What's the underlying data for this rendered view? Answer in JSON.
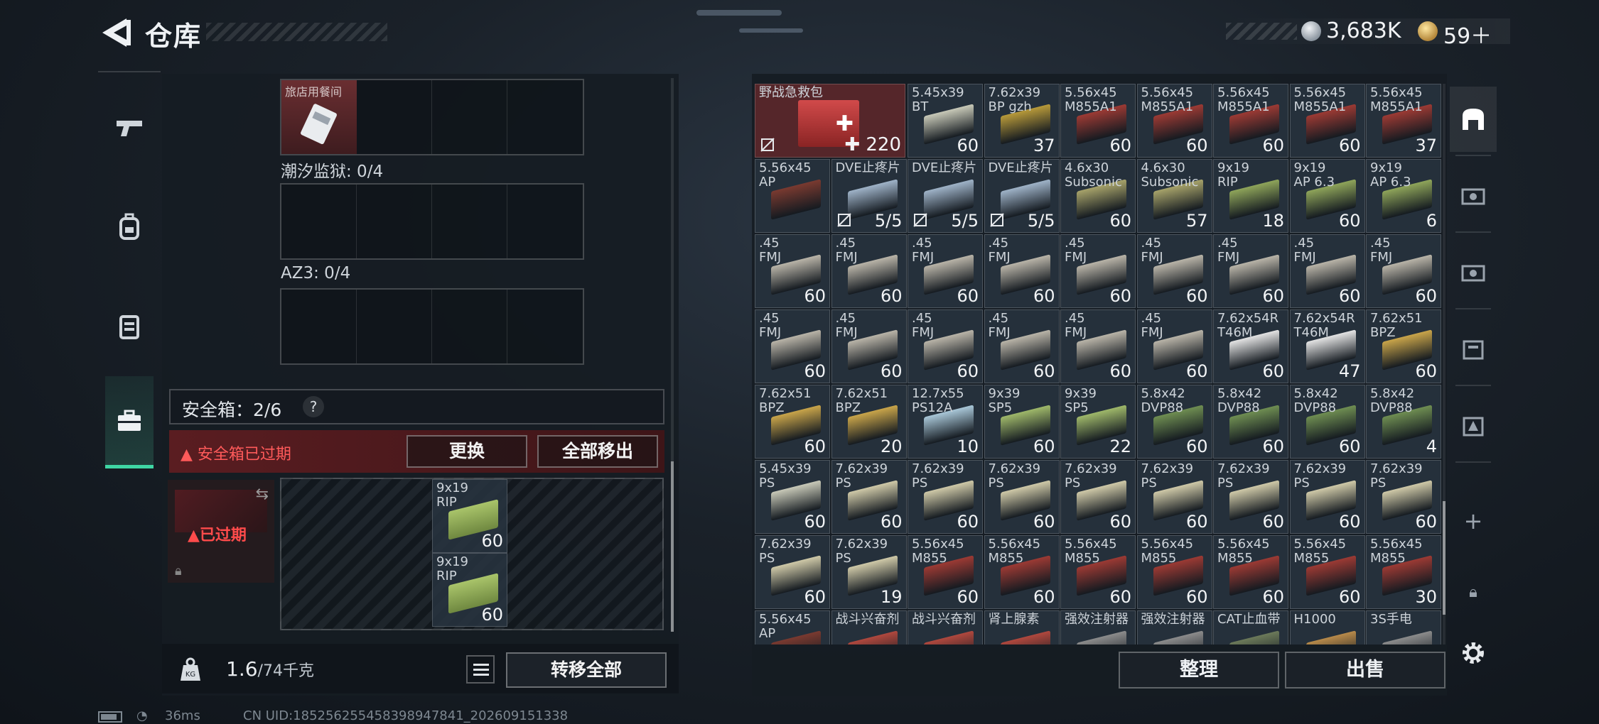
{
  "header": {
    "title": "仓库",
    "currency": [
      {
        "name": "silver-coin-icon",
        "value": "3,683K"
      },
      {
        "name": "gold-coin-icon",
        "value": "59＋"
      }
    ]
  },
  "left_tabs": [
    "pistol-icon",
    "backpack-icon",
    "vest-icon",
    "safebox-icon"
  ],
  "left_panel": {
    "top_item_name": "旅店用餐间",
    "slot_labels": [
      "潮汐监狱: 0/4",
      "AZ3: 0/4"
    ],
    "safebox_label": "安全箱：2/6",
    "safebox_help": "?",
    "expired_warning": "安全箱已过期",
    "replace_button": "更换",
    "remove_all_button": "全部移出",
    "expired_badge": "已过期",
    "safe_items": [
      {
        "name": "9x19\nRIP",
        "count": "60"
      },
      {
        "name": "9x19\nRIP",
        "count": "60"
      }
    ],
    "weight_value": "1.6",
    "weight_capacity": "/74千克",
    "transfer_all_button": "转移全部"
  },
  "stash": {
    "items": [
      {
        "name": "野战急救包",
        "count": "220",
        "color": "#c23b3b",
        "wide": true
      },
      {
        "name": "5.45x39\nBT",
        "count": "60",
        "color": "#c8c9b8"
      },
      {
        "name": "7.62x39\nBP gzh",
        "count": "37",
        "color": "#b89a3a"
      },
      {
        "name": "5.56x45\nM855A1",
        "count": "60",
        "color": "#9c3a34"
      },
      {
        "name": "5.56x45\nM855A1",
        "count": "60",
        "color": "#9c3a34"
      },
      {
        "name": "5.56x45\nM855A1",
        "count": "60",
        "color": "#9c3a34"
      },
      {
        "name": "5.56x45\nM855A1",
        "count": "60",
        "color": "#9c3a34"
      },
      {
        "name": "5.56x45\nM855A1",
        "count": "37",
        "color": "#9c3a34"
      },
      {
        "name": "5.56x45\nAP",
        "count": "",
        "color": "#7a3a30"
      },
      {
        "name": "DVE止疼片",
        "count": "5/5",
        "color": "#9fb3c8"
      },
      {
        "name": "DVE止疼片",
        "count": "5/5",
        "color": "#9fb3c8"
      },
      {
        "name": "DVE止疼片",
        "count": "5/5",
        "color": "#9fb3c8"
      },
      {
        "name": "4.6x30\nSubsonic",
        "count": "60",
        "color": "#a7a36a"
      },
      {
        "name": "4.6x30\nSubsonic",
        "count": "57",
        "color": "#a7a36a"
      },
      {
        "name": "9x19\nRIP",
        "count": "18",
        "color": "#8fa55a"
      },
      {
        "name": "9x19\nAP 6.3",
        "count": "60",
        "color": "#8fa55a"
      },
      {
        "name": "9x19\nAP 6.3",
        "count": "6",
        "color": "#8fa55a"
      },
      {
        "name": ".45\nFMJ",
        "count": "60",
        "color": "#b9b4a8"
      },
      {
        "name": ".45\nFMJ",
        "count": "60",
        "color": "#b9b4a8"
      },
      {
        "name": ".45\nFMJ",
        "count": "60",
        "color": "#b9b4a8"
      },
      {
        "name": ".45\nFMJ",
        "count": "60",
        "color": "#b9b4a8"
      },
      {
        "name": ".45\nFMJ",
        "count": "60",
        "color": "#b9b4a8"
      },
      {
        "name": ".45\nFMJ",
        "count": "60",
        "color": "#b9b4a8"
      },
      {
        "name": ".45\nFMJ",
        "count": "60",
        "color": "#b9b4a8"
      },
      {
        "name": ".45\nFMJ",
        "count": "60",
        "color": "#b9b4a8"
      },
      {
        "name": ".45\nFMJ",
        "count": "60",
        "color": "#b9b4a8"
      },
      {
        "name": ".45\nFMJ",
        "count": "60",
        "color": "#b9b4a8"
      },
      {
        "name": ".45\nFMJ",
        "count": "60",
        "color": "#b9b4a8"
      },
      {
        "name": ".45\nFMJ",
        "count": "60",
        "color": "#b9b4a8"
      },
      {
        "name": ".45\nFMJ",
        "count": "60",
        "color": "#b9b4a8"
      },
      {
        "name": ".45\nFMJ",
        "count": "60",
        "color": "#b9b4a8"
      },
      {
        "name": ".45\nFMJ",
        "count": "60",
        "color": "#b9b4a8"
      },
      {
        "name": "7.62x54R\nT46M",
        "count": "60",
        "color": "#e3e3e3"
      },
      {
        "name": "7.62x54R\nT46M",
        "count": "47",
        "color": "#e3e3e3"
      },
      {
        "name": "7.62x51\nBPZ",
        "count": "60",
        "color": "#c9a54a"
      },
      {
        "name": "7.62x51\nBPZ",
        "count": "60",
        "color": "#c9a54a"
      },
      {
        "name": "7.62x51\nBPZ",
        "count": "20",
        "color": "#c9a54a"
      },
      {
        "name": "12.7x55\nPS12A",
        "count": "10",
        "color": "#a9c7d8"
      },
      {
        "name": "9x39\nSP5",
        "count": "60",
        "color": "#9fb86a"
      },
      {
        "name": "9x39\nSP5",
        "count": "22",
        "color": "#9fb86a"
      },
      {
        "name": "5.8x42\nDVP88",
        "count": "60",
        "color": "#6f8e52"
      },
      {
        "name": "5.8x42\nDVP88",
        "count": "60",
        "color": "#6f8e52"
      },
      {
        "name": "5.8x42\nDVP88",
        "count": "60",
        "color": "#6f8e52"
      },
      {
        "name": "5.8x42\nDVP88",
        "count": "4",
        "color": "#6f8e52"
      },
      {
        "name": "5.45x39\nPS",
        "count": "60",
        "color": "#c8c9b8"
      },
      {
        "name": "7.62x39\nPS",
        "count": "60",
        "color": "#cfc9a8"
      },
      {
        "name": "7.62x39\nPS",
        "count": "60",
        "color": "#cfc9a8"
      },
      {
        "name": "7.62x39\nPS",
        "count": "60",
        "color": "#cfc9a8"
      },
      {
        "name": "7.62x39\nPS",
        "count": "60",
        "color": "#cfc9a8"
      },
      {
        "name": "7.62x39\nPS",
        "count": "60",
        "color": "#cfc9a8"
      },
      {
        "name": "7.62x39\nPS",
        "count": "60",
        "color": "#cfc9a8"
      },
      {
        "name": "7.62x39\nPS",
        "count": "60",
        "color": "#cfc9a8"
      },
      {
        "name": "7.62x39\nPS",
        "count": "60",
        "color": "#cfc9a8"
      },
      {
        "name": "7.62x39\nPS",
        "count": "60",
        "color": "#cfc9a8"
      },
      {
        "name": "7.62x39\nPS",
        "count": "19",
        "color": "#cfc9a8"
      },
      {
        "name": "5.56x45\nM855",
        "count": "60",
        "color": "#9c3a34"
      },
      {
        "name": "5.56x45\nM855",
        "count": "60",
        "color": "#9c3a34"
      },
      {
        "name": "5.56x45\nM855",
        "count": "60",
        "color": "#9c3a34"
      },
      {
        "name": "5.56x45\nM855",
        "count": "60",
        "color": "#9c3a34"
      },
      {
        "name": "5.56x45\nM855",
        "count": "60",
        "color": "#9c3a34"
      },
      {
        "name": "5.56x45\nM855",
        "count": "60",
        "color": "#9c3a34"
      },
      {
        "name": "5.56x45\nM855",
        "count": "30",
        "color": "#9c3a34"
      },
      {
        "name": "5.56x45\nAP",
        "count": "",
        "color": "#7a3a30"
      },
      {
        "name": "战斗兴奋剂",
        "count": "",
        "color": "#b0483e"
      },
      {
        "name": "战斗兴奋剂",
        "count": "",
        "color": "#b0483e"
      },
      {
        "name": "肾上腺素",
        "count": "",
        "color": "#b0483e"
      },
      {
        "name": "强效注射器",
        "count": "",
        "color": "#8c8c8c"
      },
      {
        "name": "强效注射器",
        "count": "",
        "color": "#8c8c8c"
      },
      {
        "name": "CAT止血带",
        "count": "",
        "color": "#6c7a5a"
      },
      {
        "name": "H1000",
        "count": "",
        "color": "#b88a4a"
      },
      {
        "name": "3S手电",
        "count": "",
        "color": "#8c8c8c"
      }
    ],
    "sort_button": "整理",
    "sell_button": "出售"
  },
  "right_tabs": [
    "stash-icon",
    "case-icon",
    "case-icon",
    "case-icon",
    "case-icon",
    "plus-icon",
    "lock-icon",
    "settings-icon"
  ],
  "status": {
    "ping": "36ms",
    "uid": "CN UID:185256255458398947841_202609151338"
  }
}
